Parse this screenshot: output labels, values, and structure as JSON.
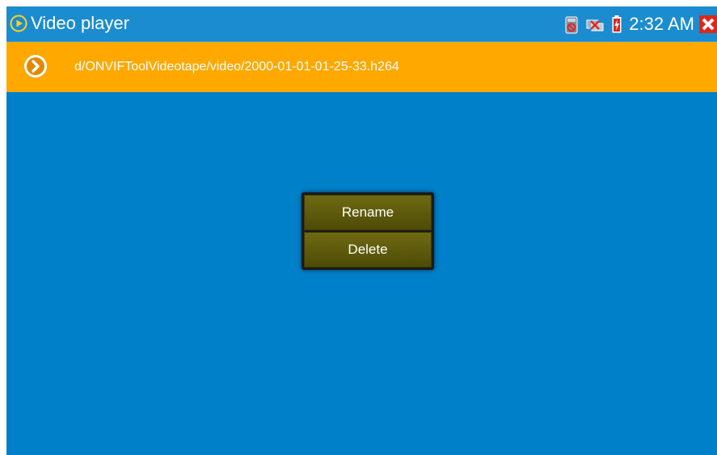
{
  "titlebar": {
    "app_title": "Video player",
    "app_icon": "play-circle-icon",
    "clock": "2:32 AM",
    "status_icons": [
      "sd-card-no-signal-icon",
      "network-disconnected-icon",
      "battery-charging-icon",
      "close-app-icon"
    ]
  },
  "pathbar": {
    "nav_icon": "forward-arrow-icon",
    "path": "d/ONVIFToolVideotape/video/2000-01-01-01-25-33.h264"
  },
  "context_menu": {
    "items": [
      {
        "label": "Rename"
      },
      {
        "label": "Delete"
      }
    ]
  },
  "colors": {
    "background": "#0080c8",
    "titlebar": "#1b8cd0",
    "pathbar": "#ffa800",
    "menu_button": "#5c5810"
  }
}
